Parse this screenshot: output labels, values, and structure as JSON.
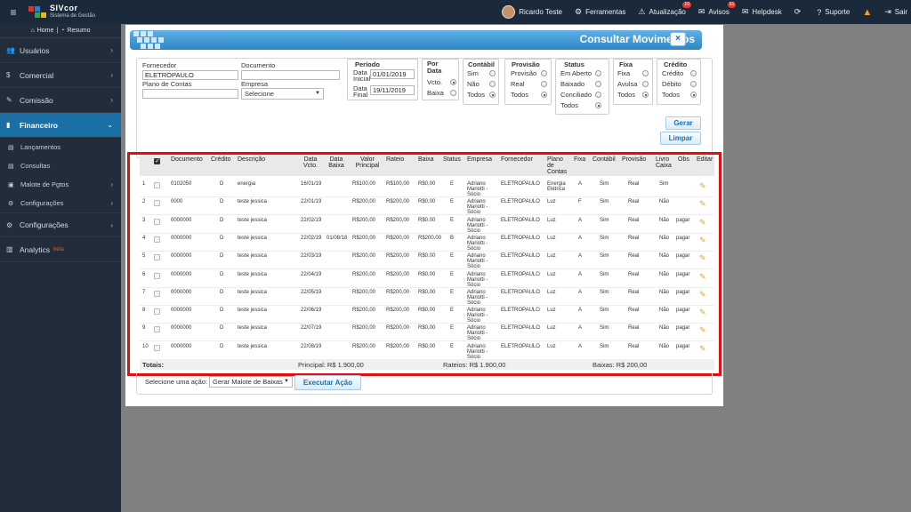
{
  "topbar": {
    "logo_title": "SIVcor",
    "logo_subtitle": "Sistema de Gestão",
    "user": "Ricardo Teste",
    "ferramentas": "Ferramentas",
    "atualizacao": "Atualização",
    "atualizacao_badge": "10",
    "avisos": "Avisos",
    "avisos_badge": "51",
    "helpdesk": "Helpdesk",
    "suporte": "Suporte",
    "sair": "Sair"
  },
  "sidebar": {
    "home": "Home",
    "resumo": "Resumo",
    "items": [
      {
        "label": "Usuários",
        "icon": "users-icon"
      },
      {
        "label": "Comercial",
        "icon": "dollar-icon"
      },
      {
        "label": "Comissão",
        "icon": "pencil-icon"
      },
      {
        "label": "Financeiro",
        "icon": "bank-icon"
      }
    ],
    "sub_items": [
      "Lançamentos",
      "Consultas",
      "Malote de Pgtos",
      "Configurações"
    ],
    "configuracoes": "Configurações",
    "analytics": "Analytics",
    "analytics_beta": "beta"
  },
  "modal": {
    "title": "Consultar Movimentos",
    "close": "×",
    "fornecedor_label": "Fornecedor",
    "fornecedor_value": "ELETROPAULO",
    "documento_label": "Documento",
    "documento_value": "",
    "plano_label": "Plano de Contas",
    "plano_value": "",
    "empresa_label": "Empresa",
    "empresa_value": "Selecione",
    "periodo_title": "Período",
    "data_inicial_label": "Data Inicial",
    "data_inicial_value": "01/01/2019",
    "data_final_label": "Data Final",
    "data_final_value": "19/11/2019",
    "por_data_title": "Por Data",
    "por_data_opts": [
      "Vcto.",
      "Baixa"
    ],
    "contabil_title": "Contábil",
    "contabil_opts": [
      "Sim",
      "Não",
      "Todos"
    ],
    "provisao_title": "Provisão",
    "provisao_opts": [
      "Provisão",
      "Real",
      "Todos"
    ],
    "status_title": "Status",
    "status_opts": [
      "Em Aberto",
      "Baixado",
      "Conciliado",
      "Todos"
    ],
    "fixa_title": "Fixa",
    "fixa_opts": [
      "Fixa",
      "Avulsa",
      "Todos"
    ],
    "credito_title": "Crédito",
    "credito_opts": [
      "Crédito",
      "Débito",
      "Todos"
    ],
    "gerar": "Gerar",
    "limpar": "Limpar"
  },
  "table": {
    "headers": {
      "documento": "Documento",
      "credito": "Crédito",
      "descricao": "Descrição",
      "data_vcto": "Data Vcto.",
      "data_baixa": "Data Baixa",
      "valor_principal": "Valor Principal",
      "rateio": "Rateio",
      "baixa": "Baixa",
      "status": "Status",
      "empresa": "Empresa",
      "fornecedor": "Fornecedor",
      "plano": "Plano de Contas",
      "fixa": "Fixa",
      "contabil": "Contábil",
      "provisao": "Provisão",
      "livro": "Livro Caixa",
      "obs": "Obs",
      "editar": "Editar"
    },
    "rows": [
      {
        "n": "1",
        "doc": "0102050",
        "cred": "D",
        "desc": "energia",
        "vcto": "16/01/19",
        "baixa_dt": "",
        "valor": "R$100,00",
        "rateio": "R$100,00",
        "baixa": "R$0,00",
        "status": "E",
        "empresa": "Adriano Mariotti - Sócio",
        "fornecedor": "ELETROPAULO",
        "plano": "Energia Elétrica",
        "fixa": "A",
        "contabil": "Sim",
        "provisao": "Real",
        "livro": "Sim",
        "obs": ""
      },
      {
        "n": "2",
        "doc": "0000",
        "cred": "D",
        "desc": "teste jessica",
        "vcto": "22/01/19",
        "baixa_dt": "",
        "valor": "R$200,00",
        "rateio": "R$200,00",
        "baixa": "R$0,00",
        "status": "E",
        "empresa": "Adriano Mariotti - Sócio",
        "fornecedor": "ELETROPAULO",
        "plano": "Luz",
        "fixa": "F",
        "contabil": "Sim",
        "provisao": "Real",
        "livro": "Não",
        "obs": ""
      },
      {
        "n": "3",
        "doc": "0000000",
        "cred": "D",
        "desc": "teste jessica",
        "vcto": "22/02/19",
        "baixa_dt": "",
        "valor": "R$200,00",
        "rateio": "R$200,00",
        "baixa": "R$0,00",
        "status": "E",
        "empresa": "Adriano Mariotti - Sócio",
        "fornecedor": "ELETROPAULO",
        "plano": "Luz",
        "fixa": "A",
        "contabil": "Sim",
        "provisao": "Real",
        "livro": "Não",
        "obs": "pagar"
      },
      {
        "n": "4",
        "doc": "0000000",
        "cred": "D",
        "desc": "teste jessica",
        "vcto": "22/02/19",
        "baixa_dt": "01/08/18",
        "valor": "R$200,00",
        "rateio": "R$200,00",
        "baixa": "R$200,00",
        "status": "B",
        "empresa": "Adriano Mariotti - Sócio",
        "fornecedor": "ELETROPAULO",
        "plano": "Luz",
        "fixa": "A",
        "contabil": "Sim",
        "provisao": "Real",
        "livro": "Não",
        "obs": "pagar"
      },
      {
        "n": "5",
        "doc": "0000000",
        "cred": "D",
        "desc": "teste jessica",
        "vcto": "22/03/19",
        "baixa_dt": "",
        "valor": "R$200,00",
        "rateio": "R$200,00",
        "baixa": "R$0,00",
        "status": "E",
        "empresa": "Adriano Mariotti - Sócio",
        "fornecedor": "ELETROPAULO",
        "plano": "Luz",
        "fixa": "A",
        "contabil": "Sim",
        "provisao": "Real",
        "livro": "Não",
        "obs": "pagar"
      },
      {
        "n": "6",
        "doc": "0000000",
        "cred": "D",
        "desc": "teste jessica",
        "vcto": "22/04/19",
        "baixa_dt": "",
        "valor": "R$200,00",
        "rateio": "R$200,00",
        "baixa": "R$0,00",
        "status": "E",
        "empresa": "Adriano Mariotti - Sócio",
        "fornecedor": "ELETROPAULO",
        "plano": "Luz",
        "fixa": "A",
        "contabil": "Sim",
        "provisao": "Real",
        "livro": "Não",
        "obs": "pagar"
      },
      {
        "n": "7",
        "doc": "0000000",
        "cred": "D",
        "desc": "teste jessica",
        "vcto": "22/05/19",
        "baixa_dt": "",
        "valor": "R$200,00",
        "rateio": "R$200,00",
        "baixa": "R$0,00",
        "status": "E",
        "empresa": "Adriano Mariotti - Sócio",
        "fornecedor": "ELETROPAULO",
        "plano": "Luz",
        "fixa": "A",
        "contabil": "Sim",
        "provisao": "Real",
        "livro": "Não",
        "obs": "pagar"
      },
      {
        "n": "8",
        "doc": "0000000",
        "cred": "D",
        "desc": "teste jessica",
        "vcto": "22/06/19",
        "baixa_dt": "",
        "valor": "R$200,00",
        "rateio": "R$200,00",
        "baixa": "R$0,00",
        "status": "E",
        "empresa": "Adriano Mariotti - Sócio",
        "fornecedor": "ELETROPAULO",
        "plano": "Luz",
        "fixa": "A",
        "contabil": "Sim",
        "provisao": "Real",
        "livro": "Não",
        "obs": "pagar"
      },
      {
        "n": "9",
        "doc": "0000000",
        "cred": "D",
        "desc": "teste jessica",
        "vcto": "22/07/19",
        "baixa_dt": "",
        "valor": "R$200,00",
        "rateio": "R$200,00",
        "baixa": "R$0,00",
        "status": "E",
        "empresa": "Adriano Mariotti - Sócio",
        "fornecedor": "ELETROPAULO",
        "plano": "Luz",
        "fixa": "A",
        "contabil": "Sim",
        "provisao": "Real",
        "livro": "Não",
        "obs": "pagar"
      },
      {
        "n": "10",
        "doc": "0000000",
        "cred": "D",
        "desc": "teste jessica",
        "vcto": "22/08/19",
        "baixa_dt": "",
        "valor": "R$200,00",
        "rateio": "R$200,00",
        "baixa": "R$0,00",
        "status": "E",
        "empresa": "Adriano Mariotti - Sócio",
        "fornecedor": "ELETROPAULO",
        "plano": "Luz",
        "fixa": "A",
        "contabil": "Sim",
        "provisao": "Real",
        "livro": "Não",
        "obs": "pagar"
      }
    ],
    "totals_label": "Totais:",
    "total_principal": "Principal: R$ 1.900,00",
    "total_rateios": "Rateios: R$ 1.900,00",
    "total_baixas": "Baixas: R$ 200,00"
  },
  "actions": {
    "label": "Selecione uma ação:",
    "select_value": "Gerar Malote de Baixas",
    "execute": "Executar Ação"
  }
}
